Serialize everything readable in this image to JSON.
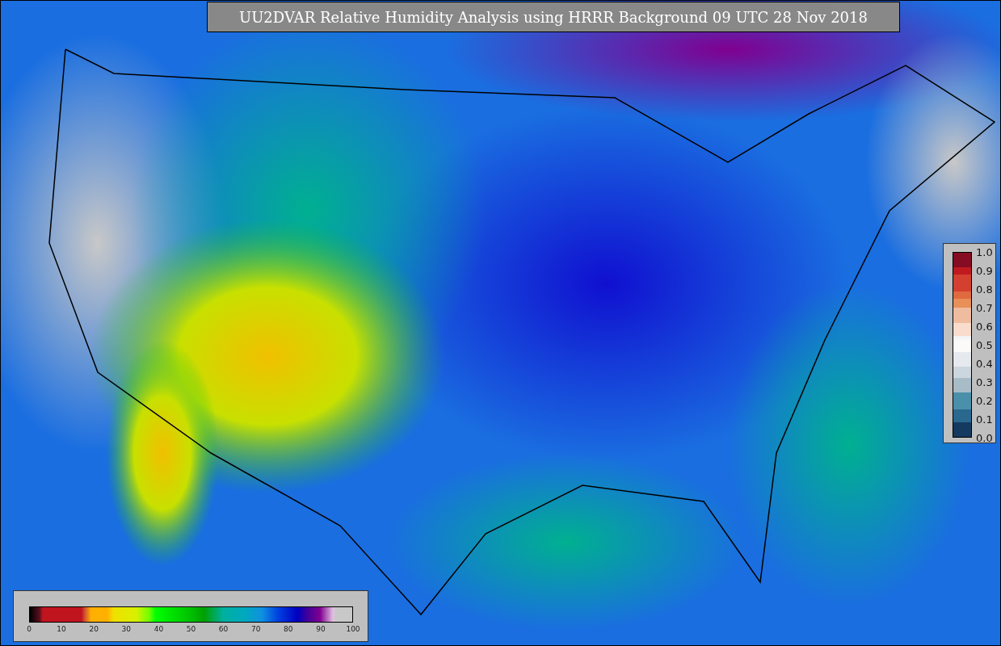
{
  "title": "UU2DVAR Relative Humidity Analysis using HRRR Background 09 UTC 28 Nov 2018",
  "colorbar_bottom": {
    "ticks": [
      "0",
      "10",
      "20",
      "30",
      "40",
      "50",
      "60",
      "70",
      "80",
      "90",
      "100"
    ]
  },
  "colorbar_right": {
    "ticks": [
      "1.0",
      "0.9",
      "0.8",
      "0.7",
      "0.6",
      "0.5",
      "0.4",
      "0.3",
      "0.2",
      "0.1",
      "0.0"
    ]
  }
}
